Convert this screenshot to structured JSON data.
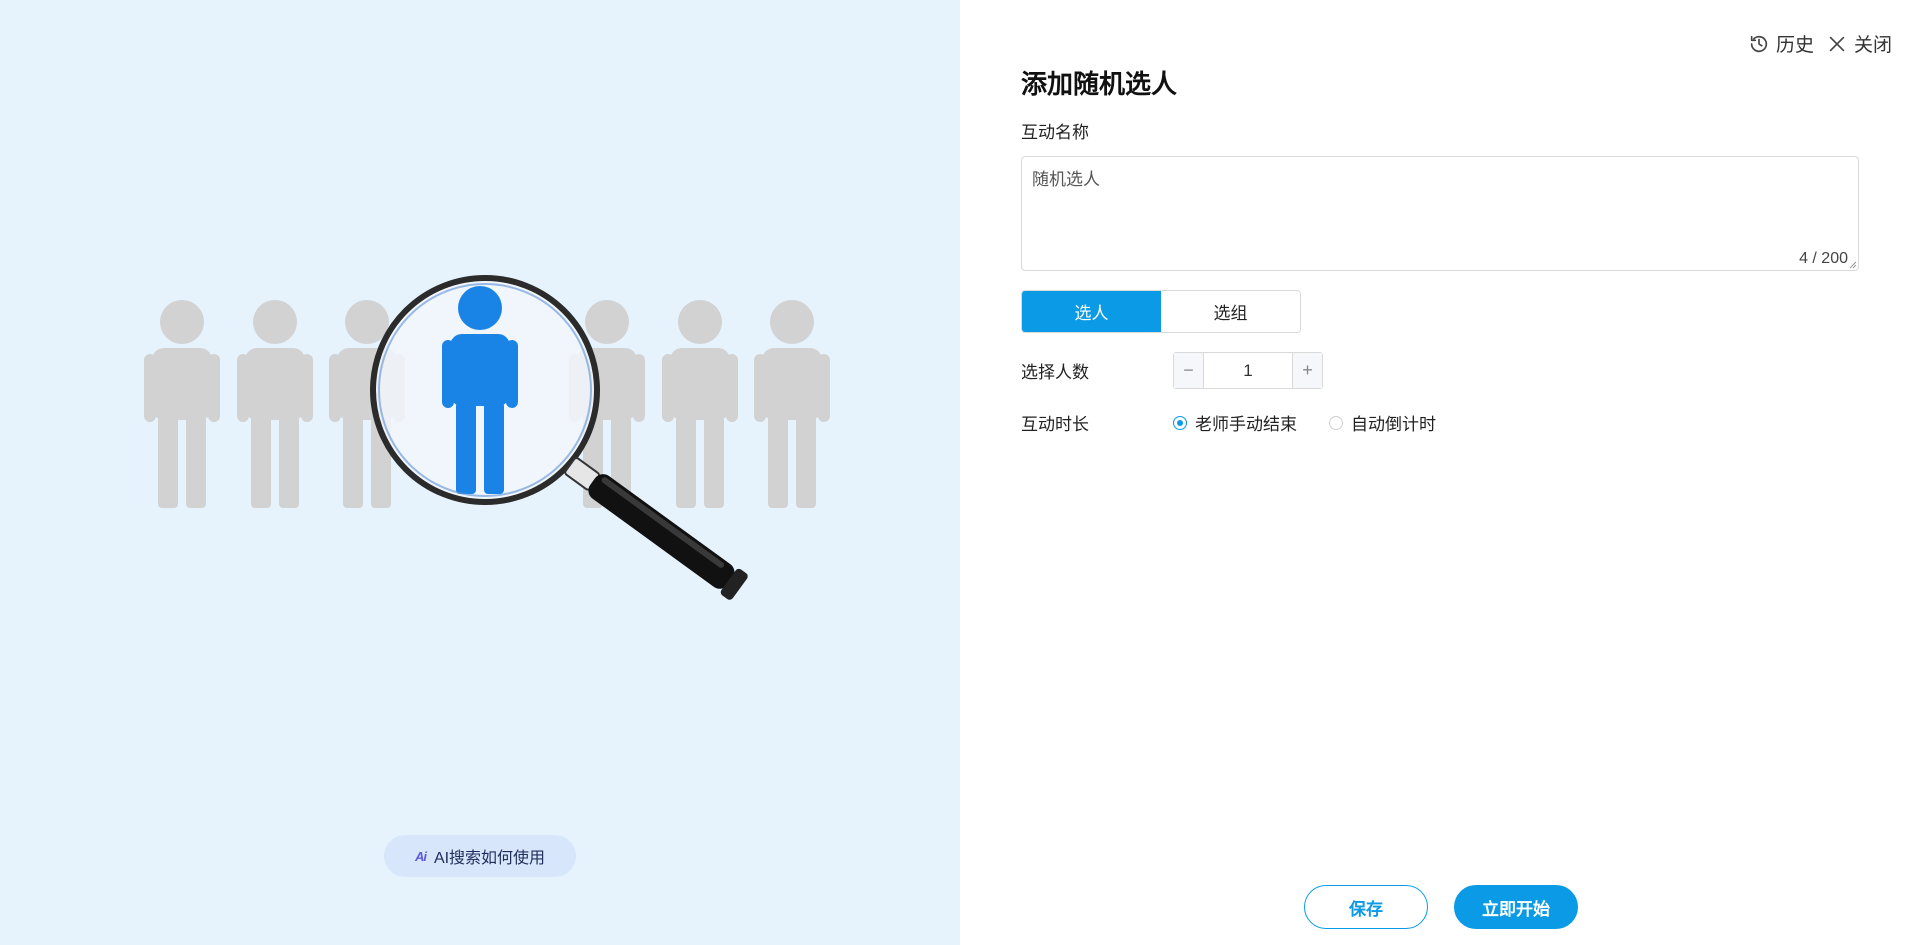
{
  "header": {
    "history_label": "历史",
    "close_label": "关闭"
  },
  "form": {
    "title": "添加随机选人",
    "name_label": "互动名称",
    "name_value": "随机选人",
    "char_count": "4 / 200",
    "mode_tabs": [
      {
        "label": "选人",
        "active": true
      },
      {
        "label": "选组",
        "active": false
      }
    ],
    "count_label": "选择人数",
    "count_value": "1",
    "duration_label": "互动时长",
    "duration_options": [
      {
        "label": "老师手动结束",
        "checked": true
      },
      {
        "label": "自动倒计时",
        "checked": false
      }
    ]
  },
  "footer": {
    "save_label": "保存",
    "start_label": "立即开始"
  },
  "left_panel": {
    "ai_icon_text": "Ai",
    "ai_help_label": "AI搜索如何使用"
  },
  "colors": {
    "accent": "#0a9ae6",
    "panel_bg": "#e6f3fd",
    "figure_gray": "#d2d2d2",
    "figure_blue": "#1a84e6"
  }
}
